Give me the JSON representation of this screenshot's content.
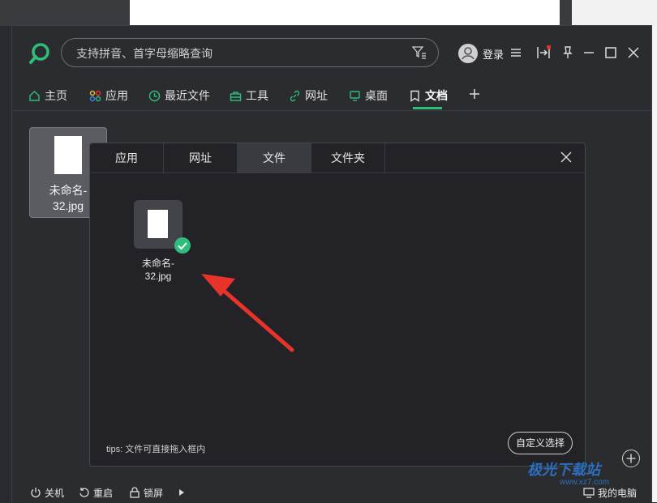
{
  "search": {
    "placeholder": "支持拼音、首字母缩略查询"
  },
  "header": {
    "login_label": "登录"
  },
  "tabs": [
    {
      "label": "主页"
    },
    {
      "label": "应用"
    },
    {
      "label": "最近文件"
    },
    {
      "label": "工具"
    },
    {
      "label": "网址"
    },
    {
      "label": "桌面"
    },
    {
      "label": "文档",
      "active": true
    }
  ],
  "main_file": {
    "name_line1": "未命名-",
    "name_line2": "32.jpg"
  },
  "dialog": {
    "tabs": [
      {
        "label": "应用"
      },
      {
        "label": "网址"
      },
      {
        "label": "文件",
        "active": true
      },
      {
        "label": "文件夹"
      }
    ],
    "file": {
      "name_line1": "未命名-",
      "name_line2": "32.jpg"
    },
    "tips": "tips: 文件可直接拖入框内",
    "custom_select_label": "自定义选择"
  },
  "footer": {
    "shutdown": "关机",
    "restart": "重启",
    "lock": "锁屏",
    "my_computer": "我的电脑"
  },
  "watermark": {
    "main": "极光下载站",
    "sub": "www.xz7.com"
  },
  "colors": {
    "accent": "#2ebd7a",
    "arrow": "#e8332a",
    "bg": "#2b2c30"
  }
}
